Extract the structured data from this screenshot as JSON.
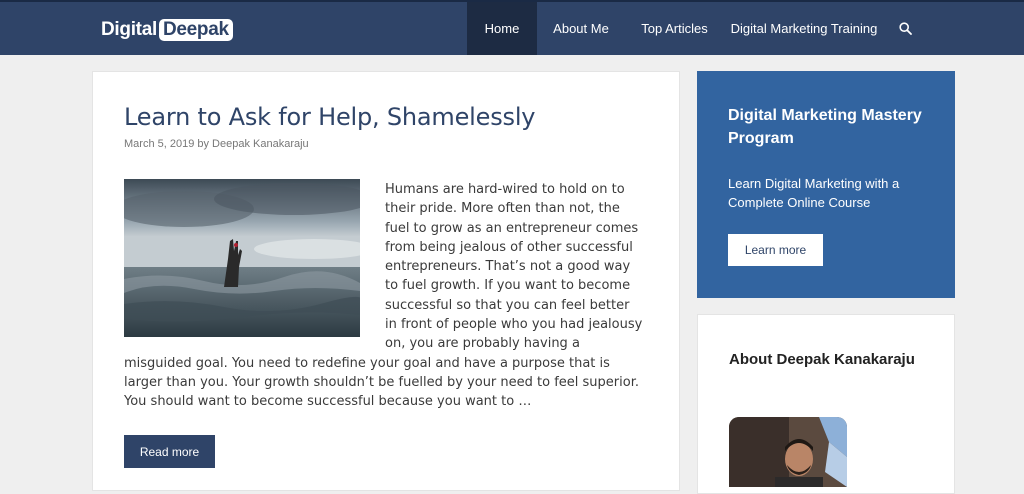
{
  "header": {
    "logo": {
      "word1": "Digital",
      "word2": "Deepak"
    },
    "nav": [
      {
        "label": "Home",
        "active": true
      },
      {
        "label": "About Me",
        "active": false
      },
      {
        "label": "Top Articles",
        "active": false
      },
      {
        "label": "Digital Marketing Training",
        "active": false
      }
    ],
    "search_icon": "search-icon"
  },
  "post": {
    "title": "Learn to Ask for Help, Shamelessly",
    "meta": "March 5, 2019 by Deepak Kanakaraju",
    "excerpt": "Humans are hard-wired to hold on to their pride. More often than not, the fuel to grow as an entrepreneur comes from being jealous of other successful entrepreneurs. That’s not a good way to fuel growth. If you want to become successful so that you can feel better in front of people who you had jealousy on, you are probably having a misguided goal. You need to redefine your goal and have a purpose that is larger than you. Your growth shouldn’t be fuelled by your need to feel superior. You should want to become successful because you want to …",
    "read_more": "Read more"
  },
  "sidebar": {
    "promo": {
      "title": "Digital Marketing Mastery Program",
      "text": "Learn Digital Marketing with a Complete Online Course",
      "button": "Learn more"
    },
    "about": {
      "title": "About Deepak Kanakaraju"
    }
  },
  "colors": {
    "header_bg": "#2f4468",
    "nav_active_bg": "#1d2b43",
    "promo_bg": "#3264a0",
    "page_bg": "#efefef"
  }
}
